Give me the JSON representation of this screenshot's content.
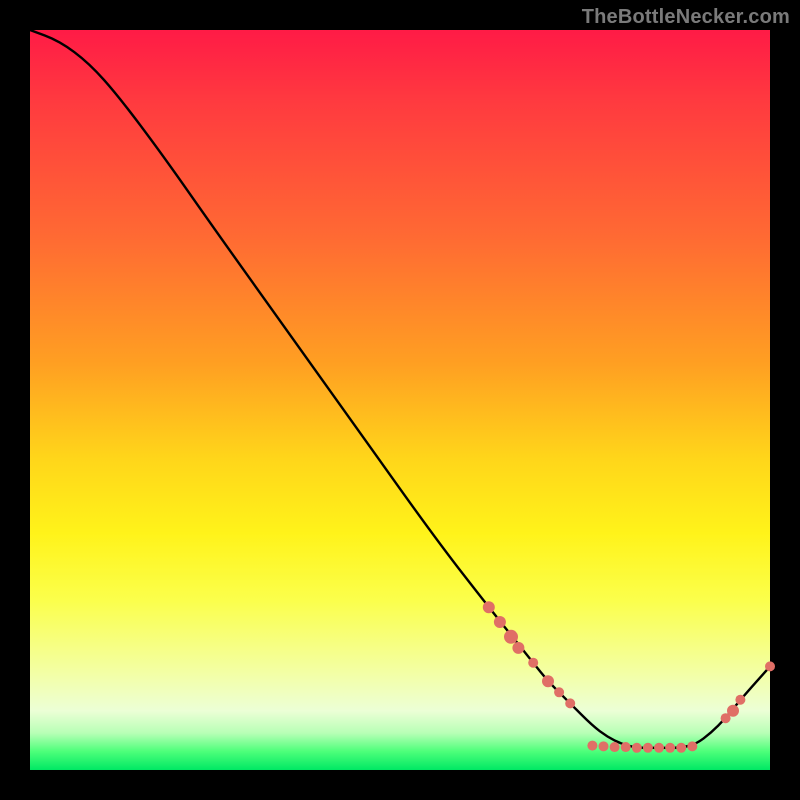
{
  "watermark": "TheBottleNecker.com",
  "chart_data": {
    "type": "line",
    "title": "",
    "xlabel": "",
    "ylabel": "",
    "xlim": [
      0,
      100
    ],
    "ylim": [
      0,
      100
    ],
    "grid": false,
    "legend": null,
    "curve": {
      "name": "bottleneck-curve",
      "color": "#000000",
      "x": [
        0,
        4,
        8,
        12,
        18,
        25,
        35,
        45,
        55,
        62,
        66,
        68,
        70,
        73,
        76,
        78,
        80,
        82,
        84,
        86,
        88,
        90,
        92,
        94,
        96,
        100
      ],
      "y": [
        100,
        98.5,
        95.5,
        91,
        83,
        73,
        59,
        45,
        31,
        22,
        17,
        14.5,
        12,
        9,
        6,
        4.5,
        3.5,
        3,
        3,
        3,
        3,
        3.5,
        5,
        7,
        9.5,
        14
      ]
    },
    "highlight_points": {
      "name": "scatter-on-curve",
      "color": "#e06f66",
      "radius": 5,
      "points": [
        {
          "x": 62,
          "y": 22,
          "r": 6
        },
        {
          "x": 63.5,
          "y": 20,
          "r": 6
        },
        {
          "x": 65,
          "y": 18,
          "r": 7
        },
        {
          "x": 66,
          "y": 16.5,
          "r": 6
        },
        {
          "x": 68,
          "y": 14.5,
          "r": 5
        },
        {
          "x": 70,
          "y": 12,
          "r": 6
        },
        {
          "x": 71.5,
          "y": 10.5,
          "r": 5
        },
        {
          "x": 73,
          "y": 9,
          "r": 5
        },
        {
          "x": 76,
          "y": 3.3,
          "r": 5
        },
        {
          "x": 77.5,
          "y": 3.2,
          "r": 5
        },
        {
          "x": 79,
          "y": 3.1,
          "r": 5
        },
        {
          "x": 80.5,
          "y": 3.1,
          "r": 5
        },
        {
          "x": 82,
          "y": 3,
          "r": 5
        },
        {
          "x": 83.5,
          "y": 3,
          "r": 5
        },
        {
          "x": 85,
          "y": 3,
          "r": 5
        },
        {
          "x": 86.5,
          "y": 3,
          "r": 5
        },
        {
          "x": 88,
          "y": 3,
          "r": 5
        },
        {
          "x": 89.5,
          "y": 3.2,
          "r": 5
        },
        {
          "x": 94,
          "y": 7,
          "r": 5
        },
        {
          "x": 95,
          "y": 8,
          "r": 6
        },
        {
          "x": 96,
          "y": 9.5,
          "r": 5
        },
        {
          "x": 100,
          "y": 14,
          "r": 5
        }
      ]
    }
  }
}
